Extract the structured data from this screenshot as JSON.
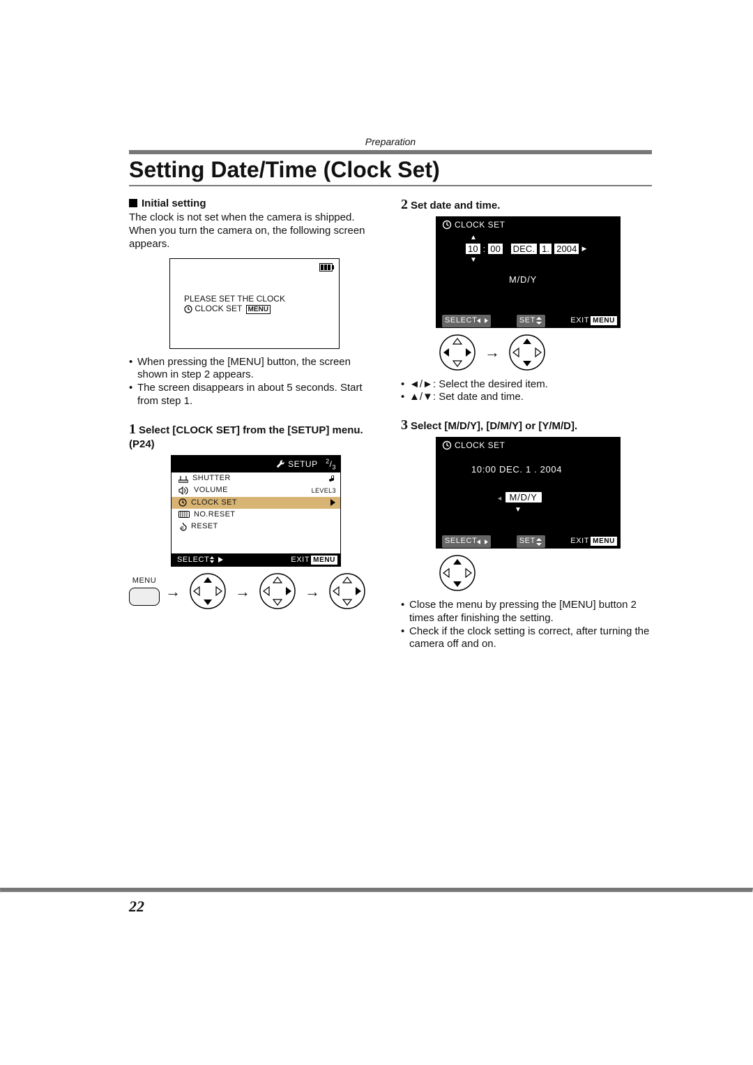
{
  "section": "Preparation",
  "title": "Setting Date/Time (Clock Set)",
  "initial": {
    "heading": "Initial setting",
    "body": "The clock is not set when the camera is shipped. When you turn the camera on, the following screen appears.",
    "warn_line1": "PLEASE SET THE CLOCK",
    "warn_line2_prefix": "CLOCK SET",
    "warn_line2_box": "MENU",
    "bullets": [
      "When pressing the [MENU] button, the screen shown in step 2 appears.",
      "The screen disappears in about 5 seconds. Start from step 1."
    ]
  },
  "step1": {
    "num": "1",
    "heading": "Select [CLOCK SET] from the [SETUP] menu. (P24)",
    "band": {
      "label": "SETUP",
      "page": "2/3"
    },
    "rows": [
      {
        "icon": "shutter-icon",
        "label": "SHUTTER",
        "tail_icon": "note-icon"
      },
      {
        "icon": "speaker-icon",
        "label": "VOLUME",
        "tail": "LEVEL3"
      },
      {
        "icon": "clock-icon",
        "label": "CLOCK SET",
        "tail_icon": "right-tri-icon",
        "active": true
      },
      {
        "icon": "counter-icon",
        "label": "NO.RESET"
      },
      {
        "icon": "reset-icon",
        "label": "RESET"
      }
    ],
    "foot": {
      "select": "SELECT",
      "exit": "EXIT",
      "exit_box": "MENU"
    },
    "menu_button_label": "MENU"
  },
  "step2": {
    "num": "2",
    "heading": "Set date and time.",
    "clock_title": "CLOCK SET",
    "fields": {
      "hour": "10",
      "minute": "00",
      "month": "DEC.",
      "day": "1.",
      "year": "2004"
    },
    "format": "M/D/Y",
    "foot": {
      "select": "SELECT",
      "set": "SET",
      "exit": "EXIT",
      "exit_box": "MENU"
    },
    "legend": [
      "◄/►: Select the desired item.",
      "▲/▼: Set date and time."
    ]
  },
  "step3": {
    "num": "3",
    "heading": "Select [M/D/Y], [D/M/Y] or [Y/M/D].",
    "clock_title": "CLOCK SET",
    "line": "10:00  DEC.  1 . 2004",
    "format": "M/D/Y",
    "foot": {
      "select": "SELECT",
      "set": "SET",
      "exit": "EXIT",
      "exit_box": "MENU"
    },
    "bullets": [
      "Close the menu by pressing the [MENU] button 2 times after finishing the setting.",
      "Check if the clock setting is correct, after turning the camera off and on."
    ]
  },
  "page_number": "22"
}
